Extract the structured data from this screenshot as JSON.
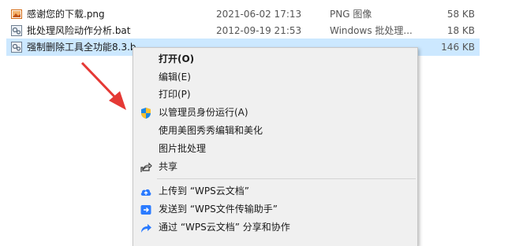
{
  "files": [
    {
      "name": "感谢您的下载.png",
      "date": "2021-06-02 17:13",
      "type": "PNG 图像",
      "size": "58 KB",
      "icon": "image-file-icon"
    },
    {
      "name": "批处理风险动作分析.bat",
      "date": "2012-09-19 21:53",
      "type": "Windows 批处理...",
      "size": "18 KB",
      "icon": "batch-file-icon"
    },
    {
      "name": "强制删除工具全功能8.3.b",
      "date": "",
      "type": "",
      "size": "146 KB",
      "icon": "batch-file-icon"
    }
  ],
  "menu": {
    "open": "打开(O)",
    "edit": "编辑(E)",
    "print": "打印(P)",
    "run_as_admin": "以管理员身份运行(A)",
    "meitu": "使用美图秀秀编辑和美化",
    "batch_image": "图片批处理",
    "share": "共享",
    "upload_wps": "上传到 “WPS云文档”",
    "send_wps": "发送到 “WPS文件传输助手”",
    "share_wps": "通过 “WPS云文档” 分享和协作"
  },
  "colors": {
    "selection": "#cce8ff",
    "arrow": "#e53935",
    "menu_bg": "#f0f0f0",
    "wps_blue": "#2b7bff"
  }
}
